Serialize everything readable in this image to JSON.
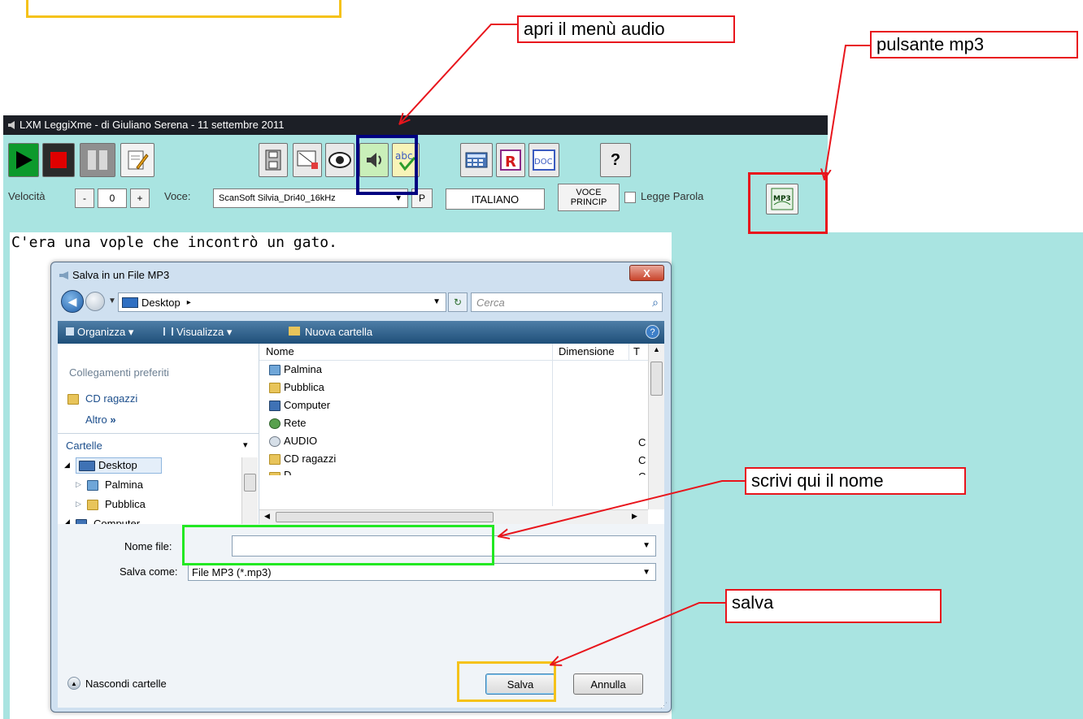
{
  "annotations": {
    "audio_menu": "apri il menù audio",
    "mp3_button": "pulsante mp3",
    "write_name": "scrivi qui il nome",
    "save": "salva"
  },
  "app": {
    "title": "LXM  LeggiXme - di Giuliano Serena - 11 settembre 2011",
    "speed_label": "Velocità",
    "speed_minus": "-",
    "speed_value": "0",
    "speed_plus": "+",
    "voice_label": "Voce:",
    "voice_value": "ScanSoft Silvia_Dri40_16kHz",
    "p_button": "P",
    "language": "ITALIANO",
    "main_voice_line1": "VOCE",
    "main_voice_line2": "PRINCIP",
    "read_word_label": "Legge Parola",
    "help_button": "?",
    "abc_label": "abc",
    "r_label": "R",
    "doc_label": "DOC",
    "mp3_label": "MP3",
    "document_text": "C'era una vople che incontrò un gato."
  },
  "dialog": {
    "title": "Salva in un File MP3",
    "close": "X",
    "breadcrumb": "Desktop",
    "breadcrumb_sep": "▸",
    "search_placeholder": "Cerca",
    "toolbar": {
      "organize": "Organizza",
      "view": "Visualizza",
      "new_folder": "Nuova cartella"
    },
    "favorites_header": "Collegamenti preferiti",
    "favorites": [
      "CD ragazzi"
    ],
    "more": "Altro",
    "more_chevron": "»",
    "folders_header": "Cartelle",
    "tree": [
      "Desktop",
      "Palmina",
      "Pubblica",
      "Computer"
    ],
    "columns": {
      "name": "Nome",
      "size": "Dimensione",
      "type": "T"
    },
    "files": [
      {
        "name": "Palmina",
        "type": ""
      },
      {
        "name": "Pubblica",
        "type": ""
      },
      {
        "name": "Computer",
        "type": ""
      },
      {
        "name": "Rete",
        "type": ""
      },
      {
        "name": "AUDIO",
        "type": "C"
      },
      {
        "name": "CD ragazzi",
        "type": "C"
      },
      {
        "name": "D",
        "type": "C"
      }
    ],
    "filename_label": "Nome file:",
    "filename_value": "",
    "savetype_label": "Salva come:",
    "savetype_value": "File MP3 (*.mp3)",
    "hide_folders": "Nascondi cartelle",
    "save_button": "Salva",
    "cancel_button": "Annulla"
  },
  "colors": {
    "app_bg": "#a9e4e1",
    "callout_border": "#e8151c",
    "audio_highlight": "#000080",
    "filename_highlight": "#22e822",
    "save_highlight": "#f5c21a"
  }
}
